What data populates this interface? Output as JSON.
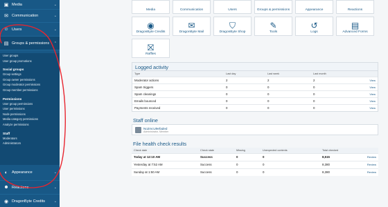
{
  "sidebar": {
    "top": [
      {
        "icon": "image-icon",
        "label": "Media"
      },
      {
        "icon": "chat-icon",
        "label": "Communication"
      },
      {
        "icon": "users-icon",
        "label": "Users"
      },
      {
        "icon": "groups-icon",
        "label": "Groups & permissions"
      }
    ],
    "sub": {
      "group1": [
        "User groups",
        "User group promotions"
      ],
      "social_head": "Social groups",
      "social": [
        "Group settings",
        "Group owner permissions",
        "Group moderator permissions",
        "Group member permissions"
      ],
      "perm_head": "Permissions",
      "perm": [
        "User group permissions",
        "User permissions",
        "Node permissions",
        "Media category permissions",
        "Analyze permissions"
      ],
      "staff_head": "Staff",
      "staff": [
        "Moderators",
        "Administrators"
      ]
    },
    "bottom": [
      {
        "icon": "palette-icon",
        "label": "Appearance"
      },
      {
        "icon": "reactions-icon",
        "label": "Reactions"
      },
      {
        "icon": "credits-icon",
        "label": "DragonByte Credits"
      }
    ]
  },
  "tiles": {
    "row1": [
      "Media",
      "Communication",
      "Users",
      "Groups & permissions",
      "Appearance",
      "Reactions"
    ],
    "row2": [
      "DragonByte Credits",
      "DragonByte Mail",
      "DragonByte Shop",
      "Tools",
      "Logs",
      "Advanced Forms"
    ],
    "row3": [
      "Raffles"
    ]
  },
  "logged_activity": {
    "title": "Logged activity",
    "headers": [
      "Type",
      "Last day",
      "Last week",
      "Last month",
      ""
    ],
    "rows": [
      [
        "Moderator actions",
        "2",
        "2",
        "2",
        "View"
      ],
      [
        "Spam triggers",
        "0",
        "0",
        "0",
        "View"
      ],
      [
        "Spam cleanings",
        "0",
        "0",
        "0",
        "View"
      ],
      [
        "Emails bounced",
        "0",
        "0",
        "0",
        "View"
      ],
      [
        "Payments received",
        "0",
        "0",
        "0",
        "View"
      ]
    ]
  },
  "staff_online": {
    "title": "Staff online",
    "name": "No2mcU9efaded",
    "role": "Administrator, Member"
  },
  "health": {
    "title": "File health check results",
    "headers": [
      "Check date",
      "Check state",
      "Missing",
      "Unexpected contents",
      "Total checked",
      ""
    ],
    "rows": [
      [
        "Today at 12:10 AM",
        "Success",
        "0",
        "0",
        "8,515",
        "Review"
      ],
      [
        "Yesterday at 7:52 AM",
        "Success",
        "0",
        "0",
        "8,380",
        "Review"
      ],
      [
        "Sunday at 1:50 AM",
        "Success",
        "0",
        "0",
        "8,380",
        "Review"
      ]
    ]
  },
  "colors": {
    "sidebar": "#185886",
    "accent": "#185886",
    "annotation": "#e8252f"
  }
}
